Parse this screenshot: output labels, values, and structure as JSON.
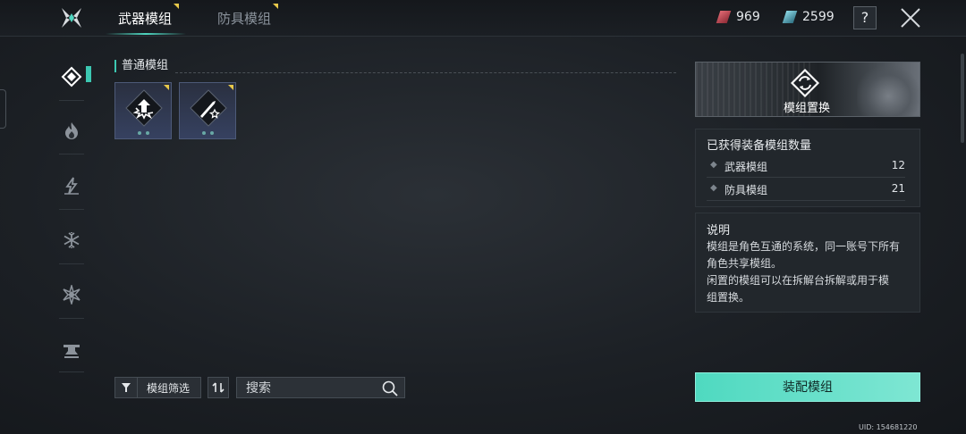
{
  "tabs": [
    {
      "label": "武器模组",
      "active": true
    },
    {
      "label": "防具模组",
      "active": false
    }
  ],
  "currency": {
    "red": {
      "value": "969",
      "color": "#c94a55"
    },
    "teal": {
      "value": "2599",
      "color": "#5fb8c8"
    }
  },
  "top_actions": {
    "help_label": "?",
    "close_icon": "close-x-icon"
  },
  "left_nav": [
    {
      "icon": "diamond-icon",
      "active": true
    },
    {
      "icon": "fire-icon",
      "active": false
    },
    {
      "icon": "lightning-icon",
      "active": false
    },
    {
      "icon": "snowflake-icon",
      "active": false
    },
    {
      "icon": "star-burst-icon",
      "active": false
    },
    {
      "icon": "anvil-icon",
      "active": false
    }
  ],
  "section": {
    "title": "普通模组"
  },
  "mods": [
    {
      "icon": "explosion-arrow-icon",
      "rarity_color": "#e8c94a"
    },
    {
      "icon": "knife-star-icon",
      "rarity_color": "#e8c94a"
    }
  ],
  "controls": {
    "filter_label": "模组筛选",
    "search_placeholder": "搜索"
  },
  "banner": {
    "label": "模组置换"
  },
  "stats": {
    "title": "已获得装备模组数量",
    "rows": [
      {
        "name": "武器模组",
        "count": "12"
      },
      {
        "name": "防具模组",
        "count": "21"
      }
    ]
  },
  "description": {
    "title": "说明",
    "lines": [
      "模组是角色互通的系统，同一账号下所有",
      "角色共享模组。",
      "闲置的模组可以在拆解台拆解或用于模",
      "组置换。"
    ]
  },
  "equip_button": {
    "label": "装配模组"
  },
  "uid": "UID: 154681220",
  "accent_color": "#3cc8b2"
}
